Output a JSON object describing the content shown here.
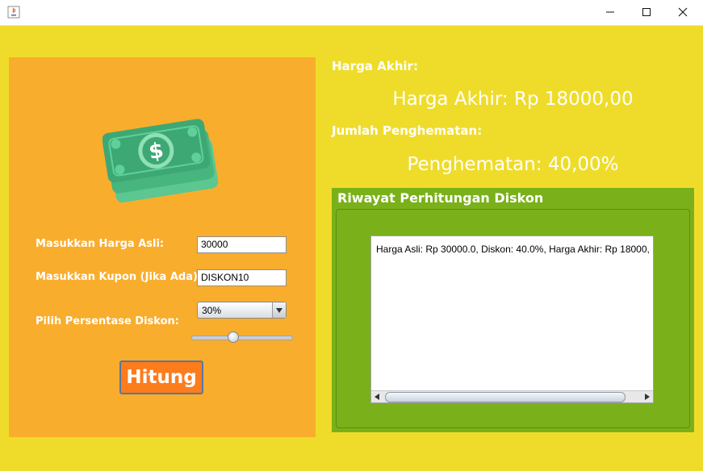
{
  "window": {
    "icons": {
      "app": "java-app-icon",
      "minimize": "minimize-icon",
      "maximize": "maximize-icon",
      "close": "close-icon"
    }
  },
  "form": {
    "price_label": "Masukkan Harga Asli:",
    "price_value": "30000",
    "coupon_label": "Masukkan Kupon (Jika Ada):",
    "coupon_value": "DISKON10",
    "discount_label": "Pilih Persentase Diskon:",
    "discount_selected": "30%",
    "slider_fraction": 0.4,
    "calculate_button": "Hitung",
    "illustration_icon": "money-bills-icon"
  },
  "results": {
    "final_heading": "Harga Akhir:",
    "final_value": "Harga Akhir: Rp 18000,00",
    "savings_heading": "Jumlah Penghematan:",
    "savings_value": "Penghematan: 40,00%"
  },
  "history": {
    "title": "Riwayat Perhitungan Diskon",
    "entries": [
      "Harga Asli: Rp 30000.0, Diskon: 40.0%, Harga Akhir: Rp 18000,"
    ]
  },
  "colors": {
    "background": "#efdc2a",
    "left_panel": "#f9ad2d",
    "button": "#fd7c1c",
    "history_panel": "#7ab11a",
    "money_green": "#3da874"
  }
}
